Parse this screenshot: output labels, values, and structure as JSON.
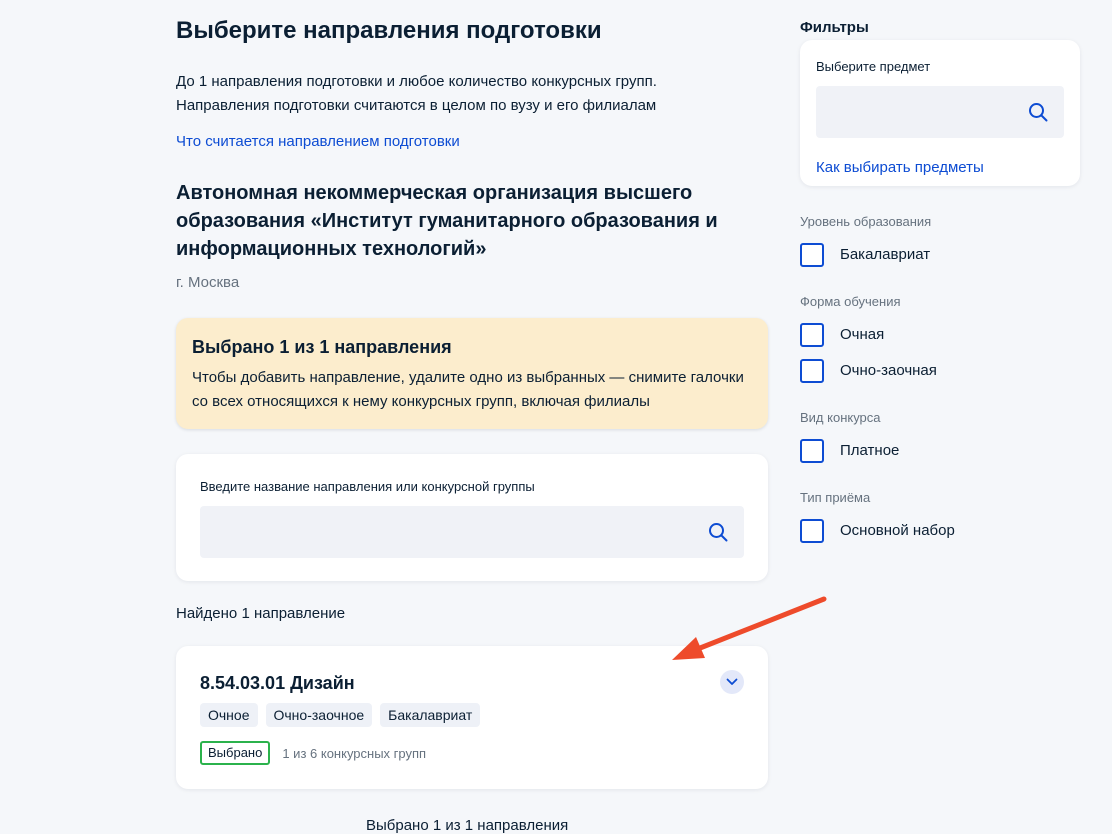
{
  "page": {
    "title": "Выберите направления подготовки",
    "intro_line1": "До 1 направления подготовки и любое количество конкурсных групп.",
    "intro_line2": "Направления подготовки считаются в целом по вузу и его филиалам",
    "intro_link": "Что считается направлением подготовки",
    "org_name": "Автономная некоммерческая организация высшего образования «Институт гуманитарного образования и информационных технологий»",
    "org_city": "г. Москва"
  },
  "notice": {
    "title": "Выбрано 1 из 1 направления",
    "text": "Чтобы добавить направление, удалите одно из выбранных — снимите галочки со всех относящихся к нему конкурсных групп, включая филиалы"
  },
  "search": {
    "label": "Введите название направления или конкурсной группы",
    "value": "",
    "icon": "search-icon"
  },
  "results": {
    "found_text": "Найдено 1 направление",
    "items": [
      {
        "title": "8.54.03.01 Дизайн",
        "tags": [
          "Очное",
          "Очно-заочное",
          "Бакалавриат"
        ],
        "status": "Выбрано",
        "groups": "1 из 6 конкурсных групп"
      }
    ],
    "bottom_text": "Выбрано 1 из 1 направления"
  },
  "filters": {
    "heading": "Фильтры",
    "subject_label": "Выберите предмет",
    "subject_value": "",
    "subject_link": "Как выбирать предметы",
    "groups": [
      {
        "label": "Уровень образования",
        "options": [
          "Бакалавриат"
        ]
      },
      {
        "label": "Форма обучения",
        "options": [
          "Очная",
          "Очно-заочная"
        ]
      },
      {
        "label": "Вид конкурса",
        "options": [
          "Платное"
        ]
      },
      {
        "label": "Тип приёма",
        "options": [
          "Основной набор"
        ]
      }
    ]
  },
  "colors": {
    "link": "#0d4cd3",
    "notice_bg": "#fcedcd",
    "selected_badge": "#2bb24c",
    "arrow": "#ee4b2b"
  }
}
